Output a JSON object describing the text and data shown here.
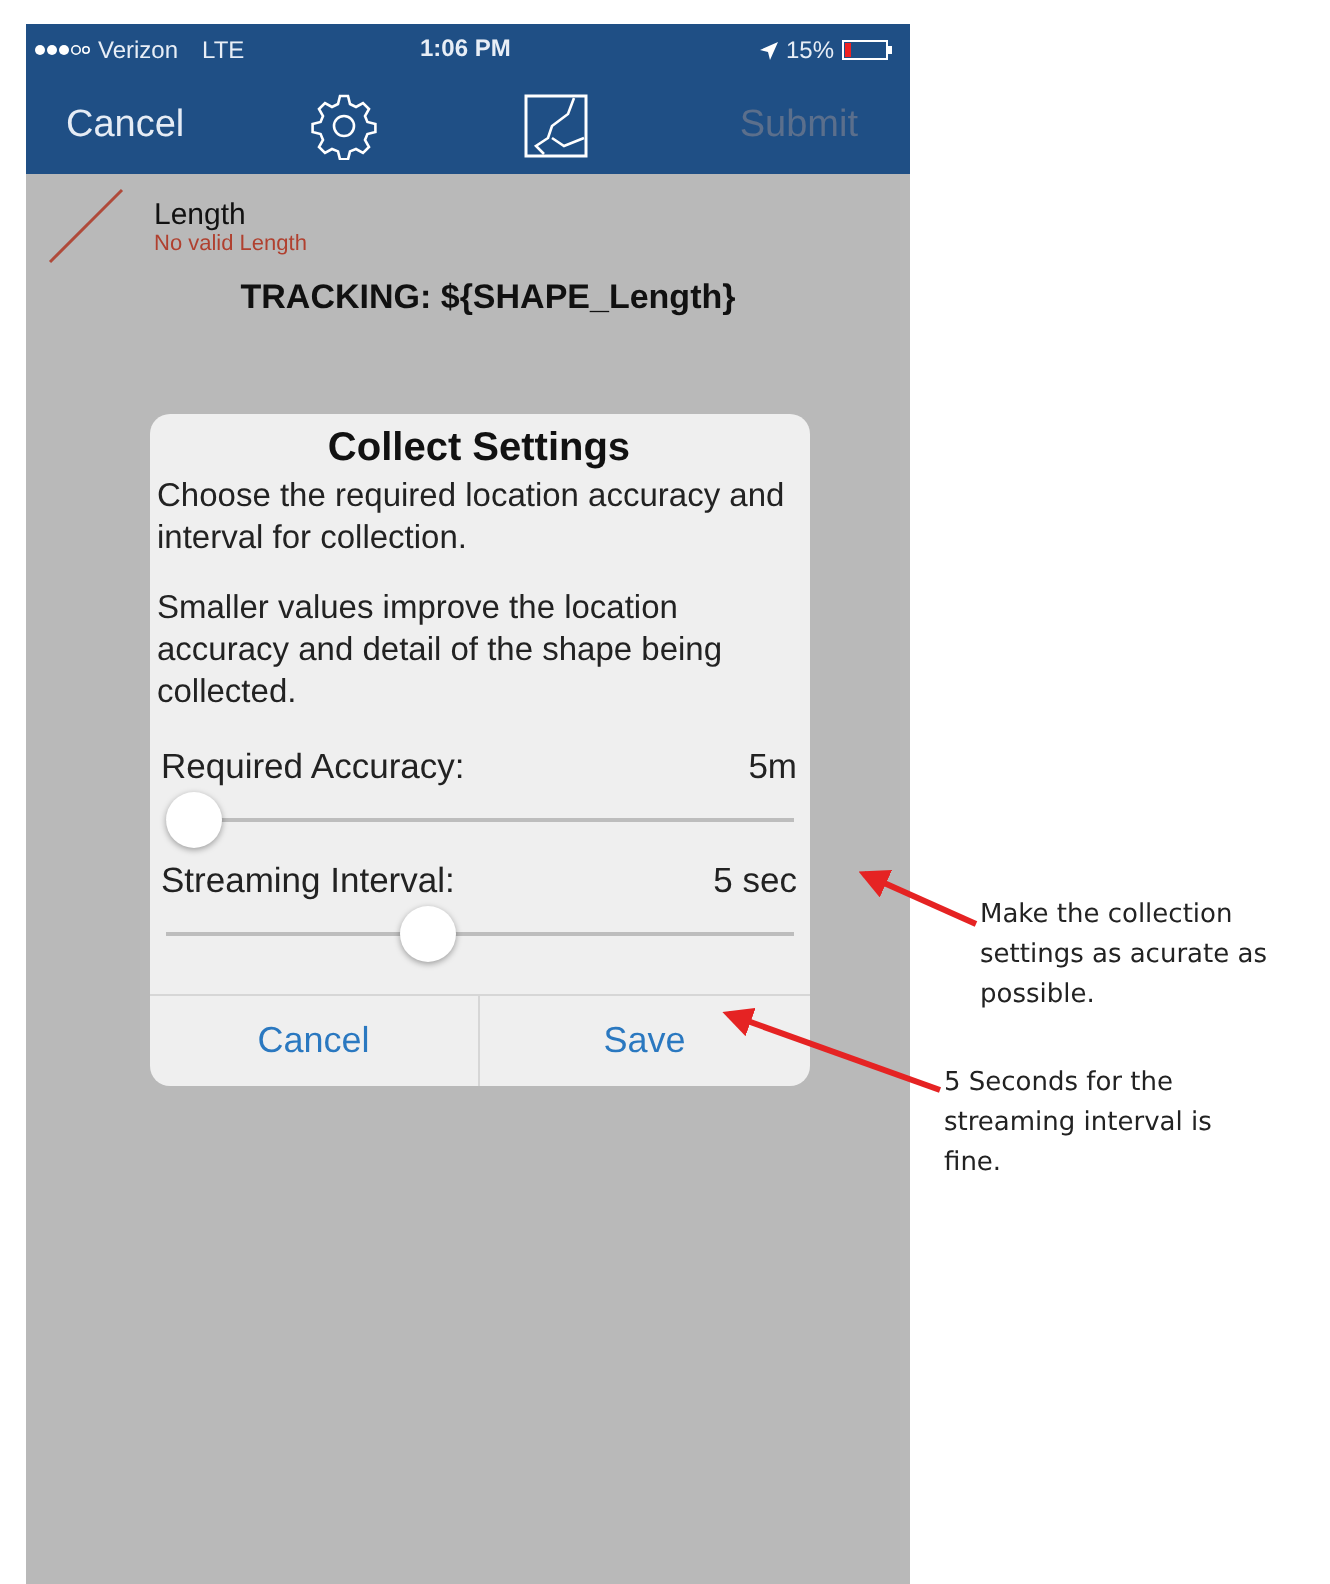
{
  "status_bar": {
    "carrier": "Verizon",
    "network": "LTE",
    "time": "1:06 PM",
    "battery": "15%"
  },
  "nav_bar": {
    "cancel": "Cancel",
    "submit": {
      "label": "Submit",
      "disabled": true
    }
  },
  "field": {
    "label": "Length",
    "error": "No valid Length"
  },
  "tracking": "TRACKING: ${SHAPE_Length}",
  "dialog": {
    "title": "Collect Settings",
    "paragraphs": [
      "Choose the required location accuracy and interval for collection.",
      "Smaller values improve the location accuracy and detail of the shape being collected."
    ],
    "sliders": [
      {
        "label": "Required Accuracy:",
        "reading": "5m",
        "level": 0.0
      },
      {
        "label": "Streaming Interval:",
        "reading": "5 sec",
        "level": 0.41
      }
    ],
    "buttons": [
      "Cancel",
      "Save"
    ]
  },
  "annotations": [
    {
      "text": "Make the collection settings as acurate as possible."
    },
    {
      "text": "5 Seconds for the streaming interval is fine."
    }
  ]
}
